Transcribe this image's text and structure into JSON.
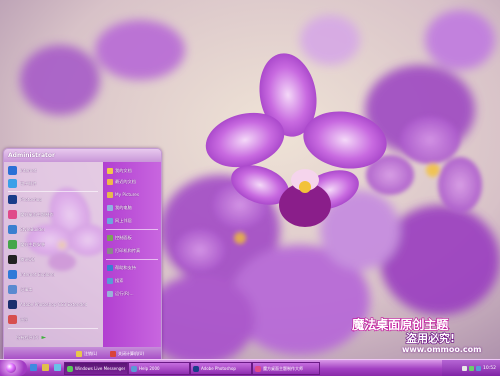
{
  "start_menu": {
    "user_name": "Administrator",
    "left_items": [
      {
        "label": "Internet",
        "icon": "globe-icon",
        "color": "#2a6fd6"
      },
      {
        "label": "电子邮件",
        "icon": "mail-icon",
        "color": "#3aa0e8"
      },
      {
        "label": "Photoshop",
        "icon": "photoshop-icon",
        "color": "#1a3d8a"
      },
      {
        "label": "魔方桌面主题制作",
        "icon": "theme-icon",
        "color": "#e04a8a"
      },
      {
        "label": "StyleBuilder",
        "icon": "stylebuilder-icon",
        "color": "#3b7fd0"
      },
      {
        "label": "魔方主题安装",
        "icon": "install-icon",
        "color": "#46a64a"
      },
      {
        "label": "腾讯QQ",
        "icon": "qq-icon",
        "color": "#222222"
      },
      {
        "label": "Internet Explorer",
        "icon": "ie-icon",
        "color": "#2f7ad8"
      },
      {
        "label": "记事本",
        "icon": "notepad-icon",
        "color": "#5a8ad0"
      },
      {
        "label": "Adobe Photoshop CS3 Extended",
        "icon": "ps-cs3-icon",
        "color": "#1a2f6e"
      },
      {
        "label": "画图",
        "icon": "paint-icon",
        "color": "#d74f4f"
      }
    ],
    "all_programs": "所有程序(P)",
    "right_items": [
      {
        "label": "我的文档",
        "icon": "documents-icon",
        "color": "#f3c94a"
      },
      {
        "label": "最近的文档",
        "icon": "recent-docs-icon",
        "color": "#f0b84a"
      },
      {
        "label": "My Pictures",
        "icon": "pictures-icon",
        "color": "#e6b94d"
      },
      {
        "label": "我的电脑",
        "icon": "computer-icon",
        "color": "#8fb2e0"
      },
      {
        "label": "网上邻居",
        "icon": "network-icon",
        "color": "#6da6de"
      },
      {
        "label": "控制面板",
        "icon": "control-panel-icon",
        "color": "#7aa35a"
      },
      {
        "label": "打印机和传真",
        "icon": "printer-icon",
        "color": "#8a8a8a"
      },
      {
        "label": "帮助和支持",
        "icon": "help-icon",
        "color": "#3a7fd1"
      },
      {
        "label": "搜索",
        "icon": "search-icon",
        "color": "#5a9ad6"
      },
      {
        "label": "运行(R)...",
        "icon": "run-icon",
        "color": "#9ab2d8"
      }
    ],
    "logoff_label": "注销(L)",
    "shutdown_label": "关闭计算机(U)"
  },
  "taskbar": {
    "tasks": [
      {
        "label": "Windows Live Messenger",
        "icon": "messenger-icon"
      },
      {
        "label": "Help 2000",
        "icon": "help-window-icon"
      },
      {
        "label": "Adobe Photoshop",
        "icon": "photoshop-task-icon"
      },
      {
        "label": "魔方桌面主题制作大师",
        "icon": "theme-task-icon"
      }
    ],
    "clock": "10:52"
  },
  "watermark": {
    "title": "魔法桌面原创主题",
    "subtitle": "盗用必究!",
    "url": "www.ommoo.com"
  },
  "colors": {
    "accent": "#b23fd1",
    "taskbar": "#a240c2",
    "watermark_pink": "#c2149b"
  }
}
